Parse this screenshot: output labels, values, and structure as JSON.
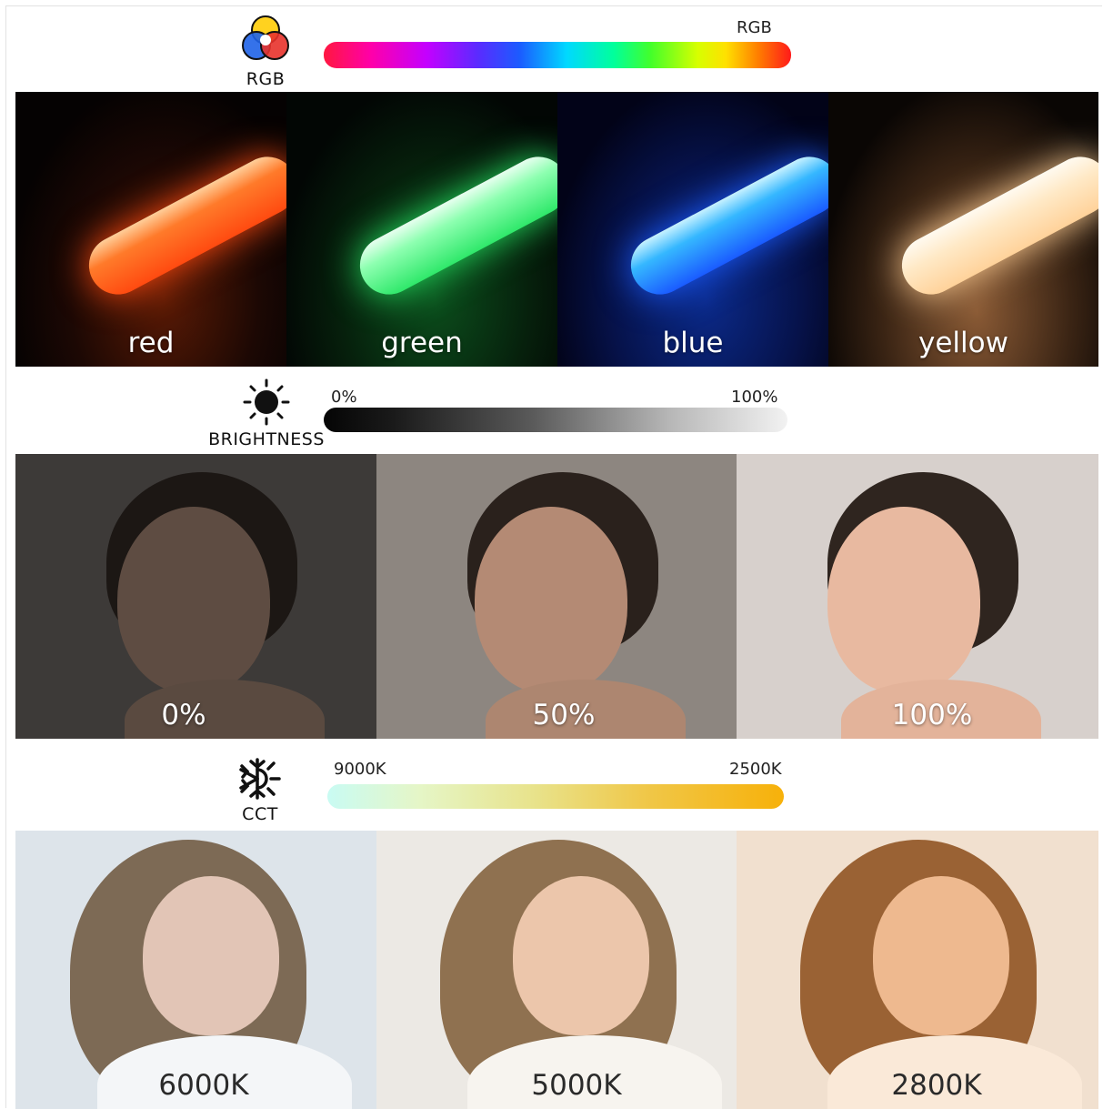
{
  "rgb_section": {
    "icon": "rgb-circles-icon",
    "icon_caption": "RGB",
    "bar_label": "RGB",
    "panels": [
      {
        "label": "red",
        "color": "#ff5a1f"
      },
      {
        "label": "green",
        "color": "#3dff7a"
      },
      {
        "label": "blue",
        "color": "#1a6bff"
      },
      {
        "label": "yellow",
        "color": "#ffd9a0"
      }
    ]
  },
  "brightness_section": {
    "icon": "sun-icon",
    "icon_caption": "BRIGHTNESS",
    "bar_min_label": "0%",
    "bar_max_label": "100%",
    "panels": [
      {
        "label": "0%",
        "background": "#3d3a38"
      },
      {
        "label": "50%",
        "background": "#8d8680"
      },
      {
        "label": "100%",
        "background": "#d7d0cc"
      }
    ]
  },
  "cct_section": {
    "icon": "snowflake-sun-icon",
    "icon_caption": "CCT",
    "bar_min_label": "9000K",
    "bar_max_label": "2500K",
    "panels": [
      {
        "label": "6000K",
        "background": "#dde4ea"
      },
      {
        "label": "5000K",
        "background": "#ece9e4"
      },
      {
        "label": "2800K",
        "background": "#f1e0cf"
      }
    ]
  }
}
